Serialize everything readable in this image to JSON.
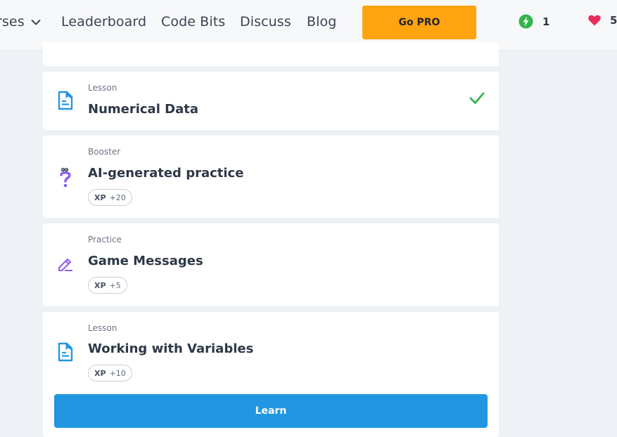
{
  "nav": {
    "courses_label": "rses",
    "leaderboard_label": "Leaderboard",
    "codebits_label": "Code Bits",
    "discuss_label": "Discuss",
    "blog_label": "Blog",
    "gopro_label": "Go PRO",
    "energy_count": "1",
    "hearts_count": "5",
    "icons": {
      "courses_chevron": "chevron-down-icon",
      "energy": "lightning-bolt-icon",
      "hearts": "heart-icon"
    },
    "colors": {
      "gopro": "#ffa310",
      "energy": "#33b54a",
      "heart": "#ea2c5c"
    }
  },
  "items": [
    {
      "type": "Lesson",
      "title": "Numerical Data",
      "icon": "lesson-document-icon",
      "completed": true
    },
    {
      "type": "Booster",
      "title": "AI-generated practice",
      "icon": "question-mark-icon",
      "xp_label": "XP",
      "xp_value": "+20"
    },
    {
      "type": "Practice",
      "title": "Game Messages",
      "icon": "pencil-icon",
      "xp_label": "XP",
      "xp_value": "+5"
    },
    {
      "type": "Lesson",
      "title": "Working with Variables",
      "icon": "lesson-document-icon",
      "xp_label": "XP",
      "xp_value": "+10",
      "button_label": "Learn"
    }
  ],
  "colors": {
    "accent": "#2296e0",
    "check": "#33b54a",
    "practice_icon": "#8a5cf0"
  }
}
